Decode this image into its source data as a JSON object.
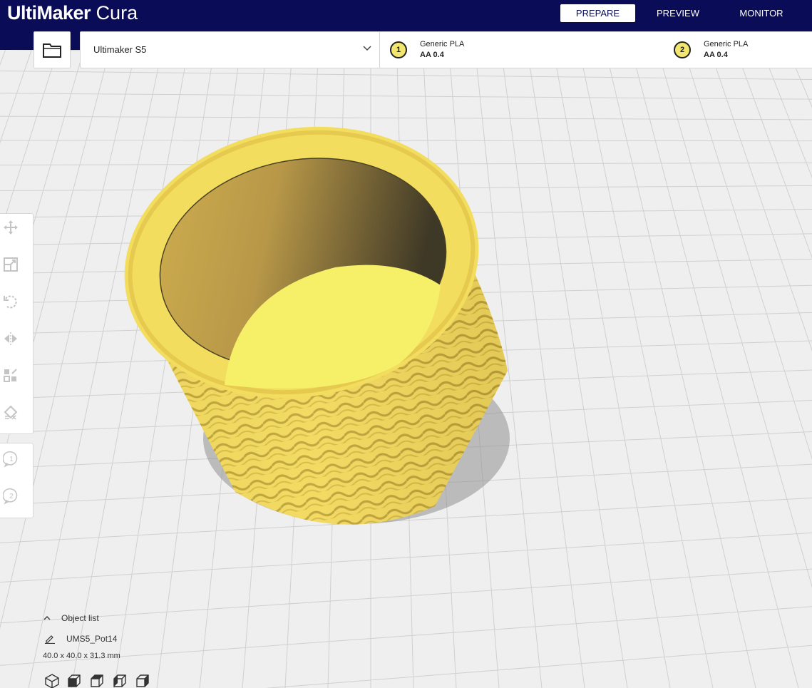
{
  "app": {
    "logo_bold": "UltiMaker",
    "logo_light": "Cura"
  },
  "stages": [
    {
      "label": "PREPARE",
      "active": true
    },
    {
      "label": "PREVIEW",
      "active": false
    },
    {
      "label": "MONITOR",
      "active": false
    }
  ],
  "printer": {
    "name": "Ultimaker S5"
  },
  "extruders": [
    {
      "number": "1",
      "material": "Generic PLA",
      "core": "AA 0.4"
    },
    {
      "number": "2",
      "material": "Generic PLA",
      "core": "AA 0.4"
    }
  ],
  "tools": [
    "move-icon",
    "scale-icon",
    "rotate-icon",
    "mirror-icon",
    "per-model-settings-icon",
    "support-blocker-icon"
  ],
  "extruder_tools": [
    "1",
    "2"
  ],
  "object_list": {
    "label": "Object list",
    "object_name": "UMS5_Pot14",
    "dimensions": "40.0 x 40.0 x 31.3 mm"
  },
  "view_buttons": [
    "view-3d-icon",
    "view-front-icon",
    "view-top-icon",
    "view-left-icon",
    "view-right-icon"
  ],
  "colors": {
    "header_bg": "#0a0c57",
    "model_yellow": "#f2e66e",
    "build_plate": "#f0f0f0",
    "grid_line": "#d2d2d2"
  }
}
